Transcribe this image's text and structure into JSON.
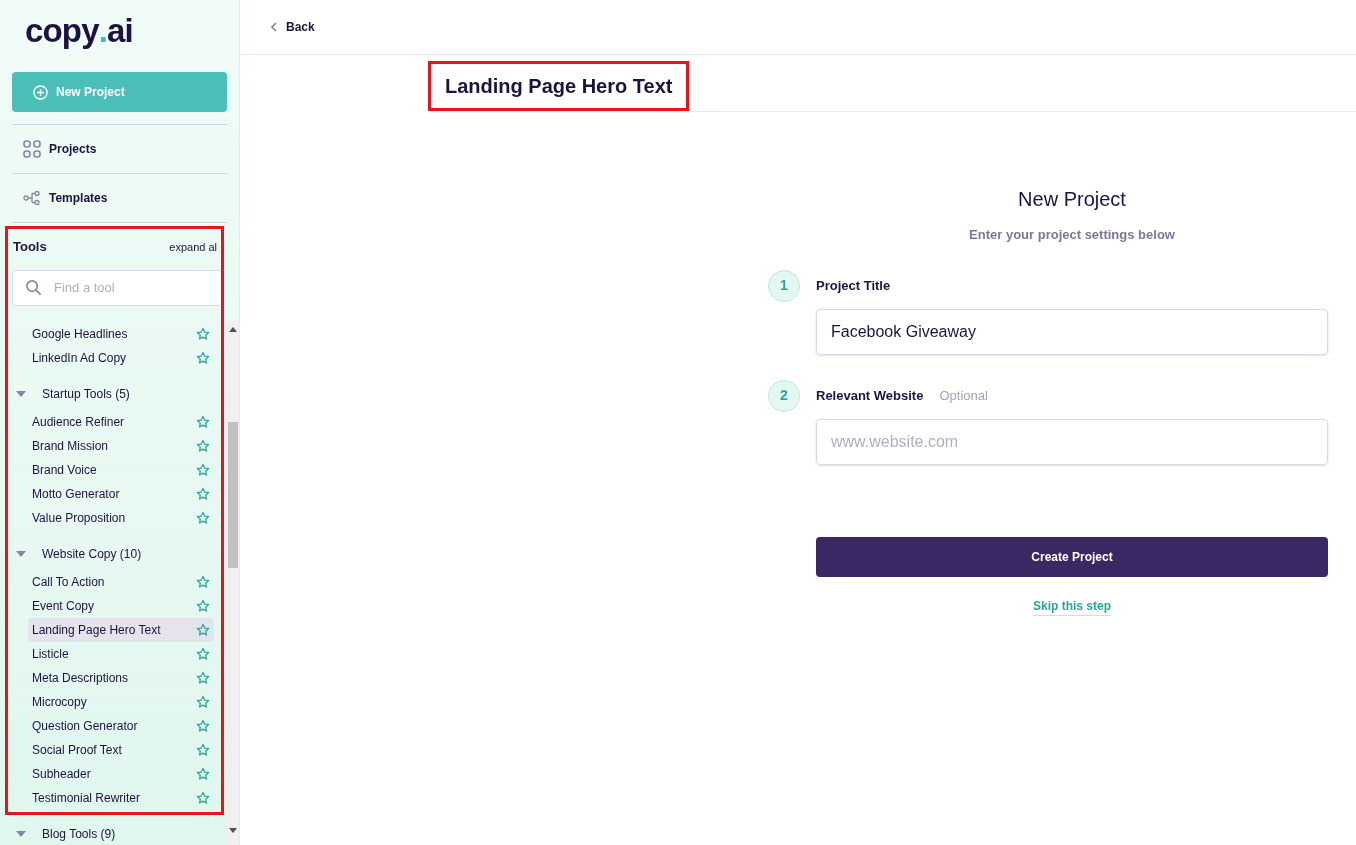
{
  "sidebar": {
    "logo": [
      "copy",
      ".",
      "ai"
    ],
    "new_project_button": "New Project",
    "nav": [
      {
        "label": "Projects"
      },
      {
        "label": "Templates"
      }
    ],
    "tools": {
      "title": "Tools",
      "expand_all": "expand al",
      "search": {
        "placeholder": "Find a tool"
      },
      "groups": [
        {
          "items": [
            {
              "label": "Google Headlines",
              "selected": false
            },
            {
              "label": "LinkedIn Ad Copy",
              "selected": false
            }
          ]
        },
        {
          "label": "Startup Tools (5)",
          "expanded": true,
          "items": [
            {
              "label": "Audience Refiner",
              "selected": false
            },
            {
              "label": "Brand Mission",
              "selected": false
            },
            {
              "label": "Brand Voice",
              "selected": false
            },
            {
              "label": "Motto Generator",
              "selected": false
            },
            {
              "label": "Value Proposition",
              "selected": false
            }
          ]
        },
        {
          "label": "Website Copy (10)",
          "expanded": true,
          "items": [
            {
              "label": "Call To Action",
              "selected": false
            },
            {
              "label": "Event Copy",
              "selected": false
            },
            {
              "label": "Landing Page Hero Text",
              "selected": true
            },
            {
              "label": "Listicle",
              "selected": false
            },
            {
              "label": "Meta Descriptions",
              "selected": false
            },
            {
              "label": "Microcopy",
              "selected": false
            },
            {
              "label": "Question Generator",
              "selected": false
            },
            {
              "label": "Social Proof Text",
              "selected": false
            },
            {
              "label": "Subheader",
              "selected": false
            },
            {
              "label": "Testimonial Rewriter",
              "selected": false
            }
          ]
        },
        {
          "label": "Blog Tools (9)",
          "expanded": true
        }
      ]
    }
  },
  "main": {
    "back": "Back",
    "page_title": "Landing Page Hero Text",
    "form": {
      "title": "New Project",
      "subtitle": "Enter your project settings below",
      "steps": [
        {
          "number": "1",
          "label": "Project Title",
          "value": "Facebook Giveaway"
        },
        {
          "number": "2",
          "label": "Relevant Website",
          "note": "Optional",
          "placeholder": "www.website.com"
        }
      ],
      "submit": "Create Project",
      "skip": "Skip this step"
    }
  }
}
